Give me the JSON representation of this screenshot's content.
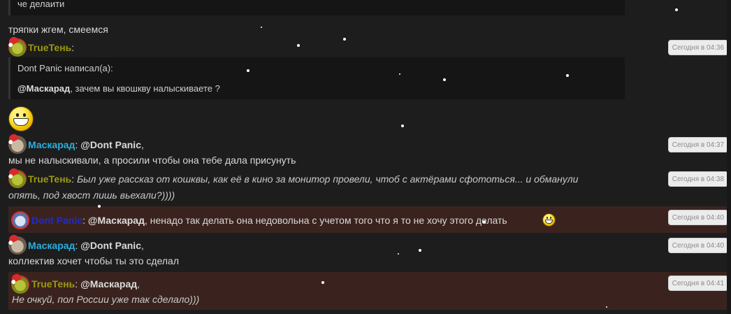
{
  "top_quote_tail": "че делаити",
  "msgs": {
    "m1": {
      "text": "тряпки жгем, смеемся"
    },
    "m2": {
      "nick": "TrueТень",
      "colon": ":",
      "time": "Сегодня в 04:36",
      "quote_author": "Dont Panic написал(а):",
      "quote_mention": "@Маскарад",
      "quote_rest": ", зачем вы квошкву налыскиваете ?"
    },
    "m3": {
      "nick": "Маскарад",
      "colon": ":",
      "mention": "@Dont Panic",
      "after_mention": ",",
      "time": "Сегодня в 04:37",
      "text": "мы не налыскивали, а просили чтобы она тебе дала присунуть"
    },
    "m4": {
      "nick": "TrueТень",
      "colon": ":",
      "time": "Сегодня в 04:38",
      "text1": "Был уже рассказ от кошквы, как её в кино за монитор провели, чтоб с актёрами сфототься... и обманули",
      "text2": "опять, под хвост лишь вьехали?))))"
    },
    "m5": {
      "nick": "Dont Panic",
      "colon": ":",
      "mention": "@Маскарад",
      "text": ", ненадо так делать она недовольна с учетом того что я то не хочу этого делать",
      "time": "Сегодня в 04:40"
    },
    "m6": {
      "nick": "Маскарад",
      "colon": ":",
      "mention": "@Dont Panic",
      "after_mention": ",",
      "time": "Сегодня в 04:40",
      "text": "коллектив хочет чтобы ты это сделал"
    },
    "m7": {
      "nick": "TrueТень",
      "colon": ":",
      "mention": "@Маскарад",
      "after_mention": ",",
      "time": "Сегодня в 04:41",
      "text": "Не очкуй, пол России уже так сделало)))"
    }
  },
  "icons": {
    "avatar_true": "avatar-true-ten",
    "avatar_mask": "avatar-maskarad",
    "avatar_dp": "avatar-dont-panic",
    "smiley": "grin-smiley-icon",
    "santa_hat": "santa-hat-icon"
  },
  "colors": {
    "nick_true": "#9a9a12",
    "nick_mask": "#28b0e0",
    "nick_dp": "#1c2bd9",
    "highlight_bg": "#3a231e",
    "page_bg": "#1d1d1d"
  }
}
